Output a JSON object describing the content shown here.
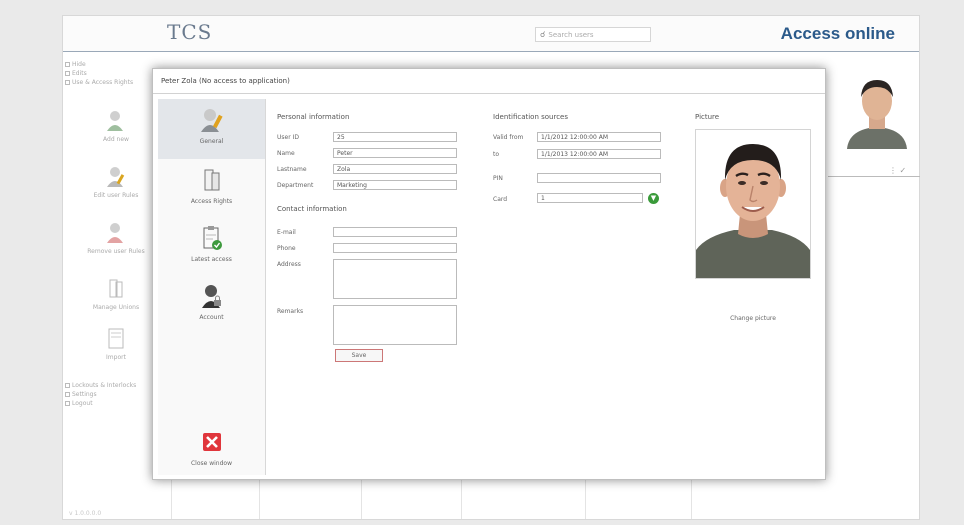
{
  "app": {
    "logo_text": "TCS",
    "search_placeholder": "Search users",
    "title": "Access online",
    "accent_color": "#2b5a8a",
    "left_menu": {
      "checkbox_top": [
        "Hide",
        "Edits",
        "Use & Access Rights"
      ],
      "tools": [
        "Add new",
        "Edit user Rules",
        "Remove user Rules",
        "Manage Unions",
        "Import"
      ],
      "checkbox_bottom": [
        "Lockouts & Interlocks",
        "Settings",
        "Logout"
      ]
    },
    "footer_text": "v 1.0.0.0.0"
  },
  "modal": {
    "title": "Peter Zola (No access to application)",
    "sidebar": {
      "items": [
        {
          "label": "General",
          "icon": "user-pen-icon"
        },
        {
          "label": "Access Rights",
          "icon": "doors-icon"
        },
        {
          "label": "Latest access",
          "icon": "clipboard-check-icon"
        },
        {
          "label": "Account",
          "icon": "user-lock-icon"
        }
      ],
      "close_label": "Close window"
    },
    "personal": {
      "title": "Personal information",
      "fields": [
        {
          "label": "User ID",
          "value": "25"
        },
        {
          "label": "Name",
          "value": "Peter"
        },
        {
          "label": "Lastname",
          "value": "Zola"
        },
        {
          "label": "Department",
          "value": "Marketing"
        }
      ]
    },
    "contact": {
      "title": "Contact information",
      "email_label": "E-mail",
      "email_value": "",
      "phone_label": "Phone",
      "phone_value": "",
      "address_label": "Address",
      "remarks_label": "Remarks"
    },
    "save_label": "Save",
    "ident": {
      "title": "Identification sources",
      "valid_from_label": "Valid from",
      "valid_from_value": "1/1/2012 12:00:00 AM",
      "to_label": "to",
      "to_value": "1/1/2013 12:00:00 AM",
      "pin_label": "PIN",
      "pin_value": "",
      "card_label": "Card",
      "card_value": "1"
    },
    "picture": {
      "title": "Picture",
      "change_label": "Change picture"
    }
  }
}
